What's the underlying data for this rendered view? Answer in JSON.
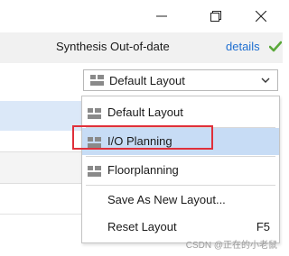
{
  "window": {
    "minimize_icon": "minimize-icon",
    "restore_icon": "restore-icon",
    "close_icon": "close-icon"
  },
  "status": {
    "text": "Synthesis Out-of-date",
    "link": "details",
    "check_icon": "checkmark-icon",
    "check_color": "#5aa83a"
  },
  "layout_selector": {
    "selected": "Default Layout",
    "icon": "layout-icon"
  },
  "menu": {
    "items": [
      {
        "label": "Default Layout",
        "icon": "layout-icon",
        "highlighted": false
      },
      {
        "label": "I/O Planning",
        "icon": "layout-icon",
        "highlighted": true
      },
      {
        "label": "Floorplanning",
        "icon": "layout-icon",
        "highlighted": false
      },
      {
        "label": "Save As New Layout...",
        "highlighted": false
      },
      {
        "label": "Reset Layout",
        "shortcut": "F5",
        "highlighted": false
      }
    ]
  },
  "colors": {
    "highlight": "#c7dcf5",
    "annotation_box": "#e0303a",
    "link": "#1f6fd1"
  },
  "watermark": "CSDN @正在的小老鼠"
}
